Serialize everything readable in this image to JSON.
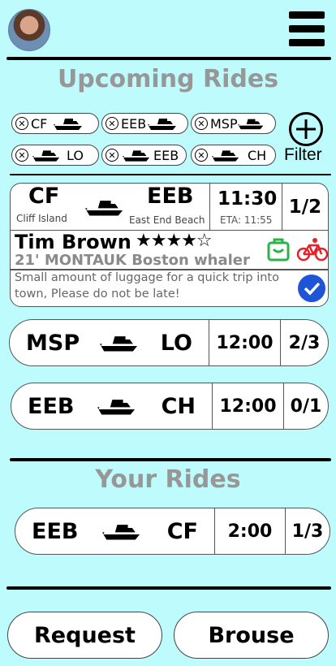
{
  "header": {
    "avatar_alt": "profile photo",
    "menu_icon": "hamburger-menu-icon"
  },
  "upcoming": {
    "title": "Upcoming Rides",
    "chips_row1": [
      {
        "text": "CF",
        "mode": "label-boat"
      },
      {
        "text": "EEB",
        "mode": "label-boat"
      },
      {
        "text": "MSP",
        "mode": "label-boat"
      }
    ],
    "chips_row2": [
      {
        "text": "LO",
        "mode": "boat-label"
      },
      {
        "text": "EEB",
        "mode": "boat-label"
      },
      {
        "text": "CH",
        "mode": "boat-label"
      }
    ],
    "filter_label": "Filter",
    "expanded_ride": {
      "from_code": "CF",
      "from_name": "Cliff Island",
      "to_code": "EEB",
      "to_name": "East End Beach",
      "time": "11:30",
      "eta": "ETA: 11:55",
      "seats": "1/2",
      "captain": "Tim Brown",
      "rating": 4,
      "rating_max": 5,
      "boat": "21' MONTAUK Boston whaler",
      "note": "Small amount of luggage for a quick trip into town, Please do not be late!",
      "accent_green": "#2bb34a",
      "accent_red": "#e8202a",
      "accent_blue": "#1e55d6"
    },
    "rides": [
      {
        "from": "MSP",
        "to": "LO",
        "time": "12:00",
        "seats": "2/3"
      },
      {
        "from": "EEB",
        "to": "CH",
        "time": "12:00",
        "seats": "0/1"
      }
    ]
  },
  "your_rides": {
    "title": "Your Rides",
    "rides": [
      {
        "from": "EEB",
        "to": "CF",
        "time": "2:00",
        "seats": "1/3"
      }
    ]
  },
  "footer": {
    "request_label": "Request",
    "browse_label": "Brouse"
  },
  "colors": {
    "background": "#bdfbfc",
    "title_gray": "#979797"
  }
}
